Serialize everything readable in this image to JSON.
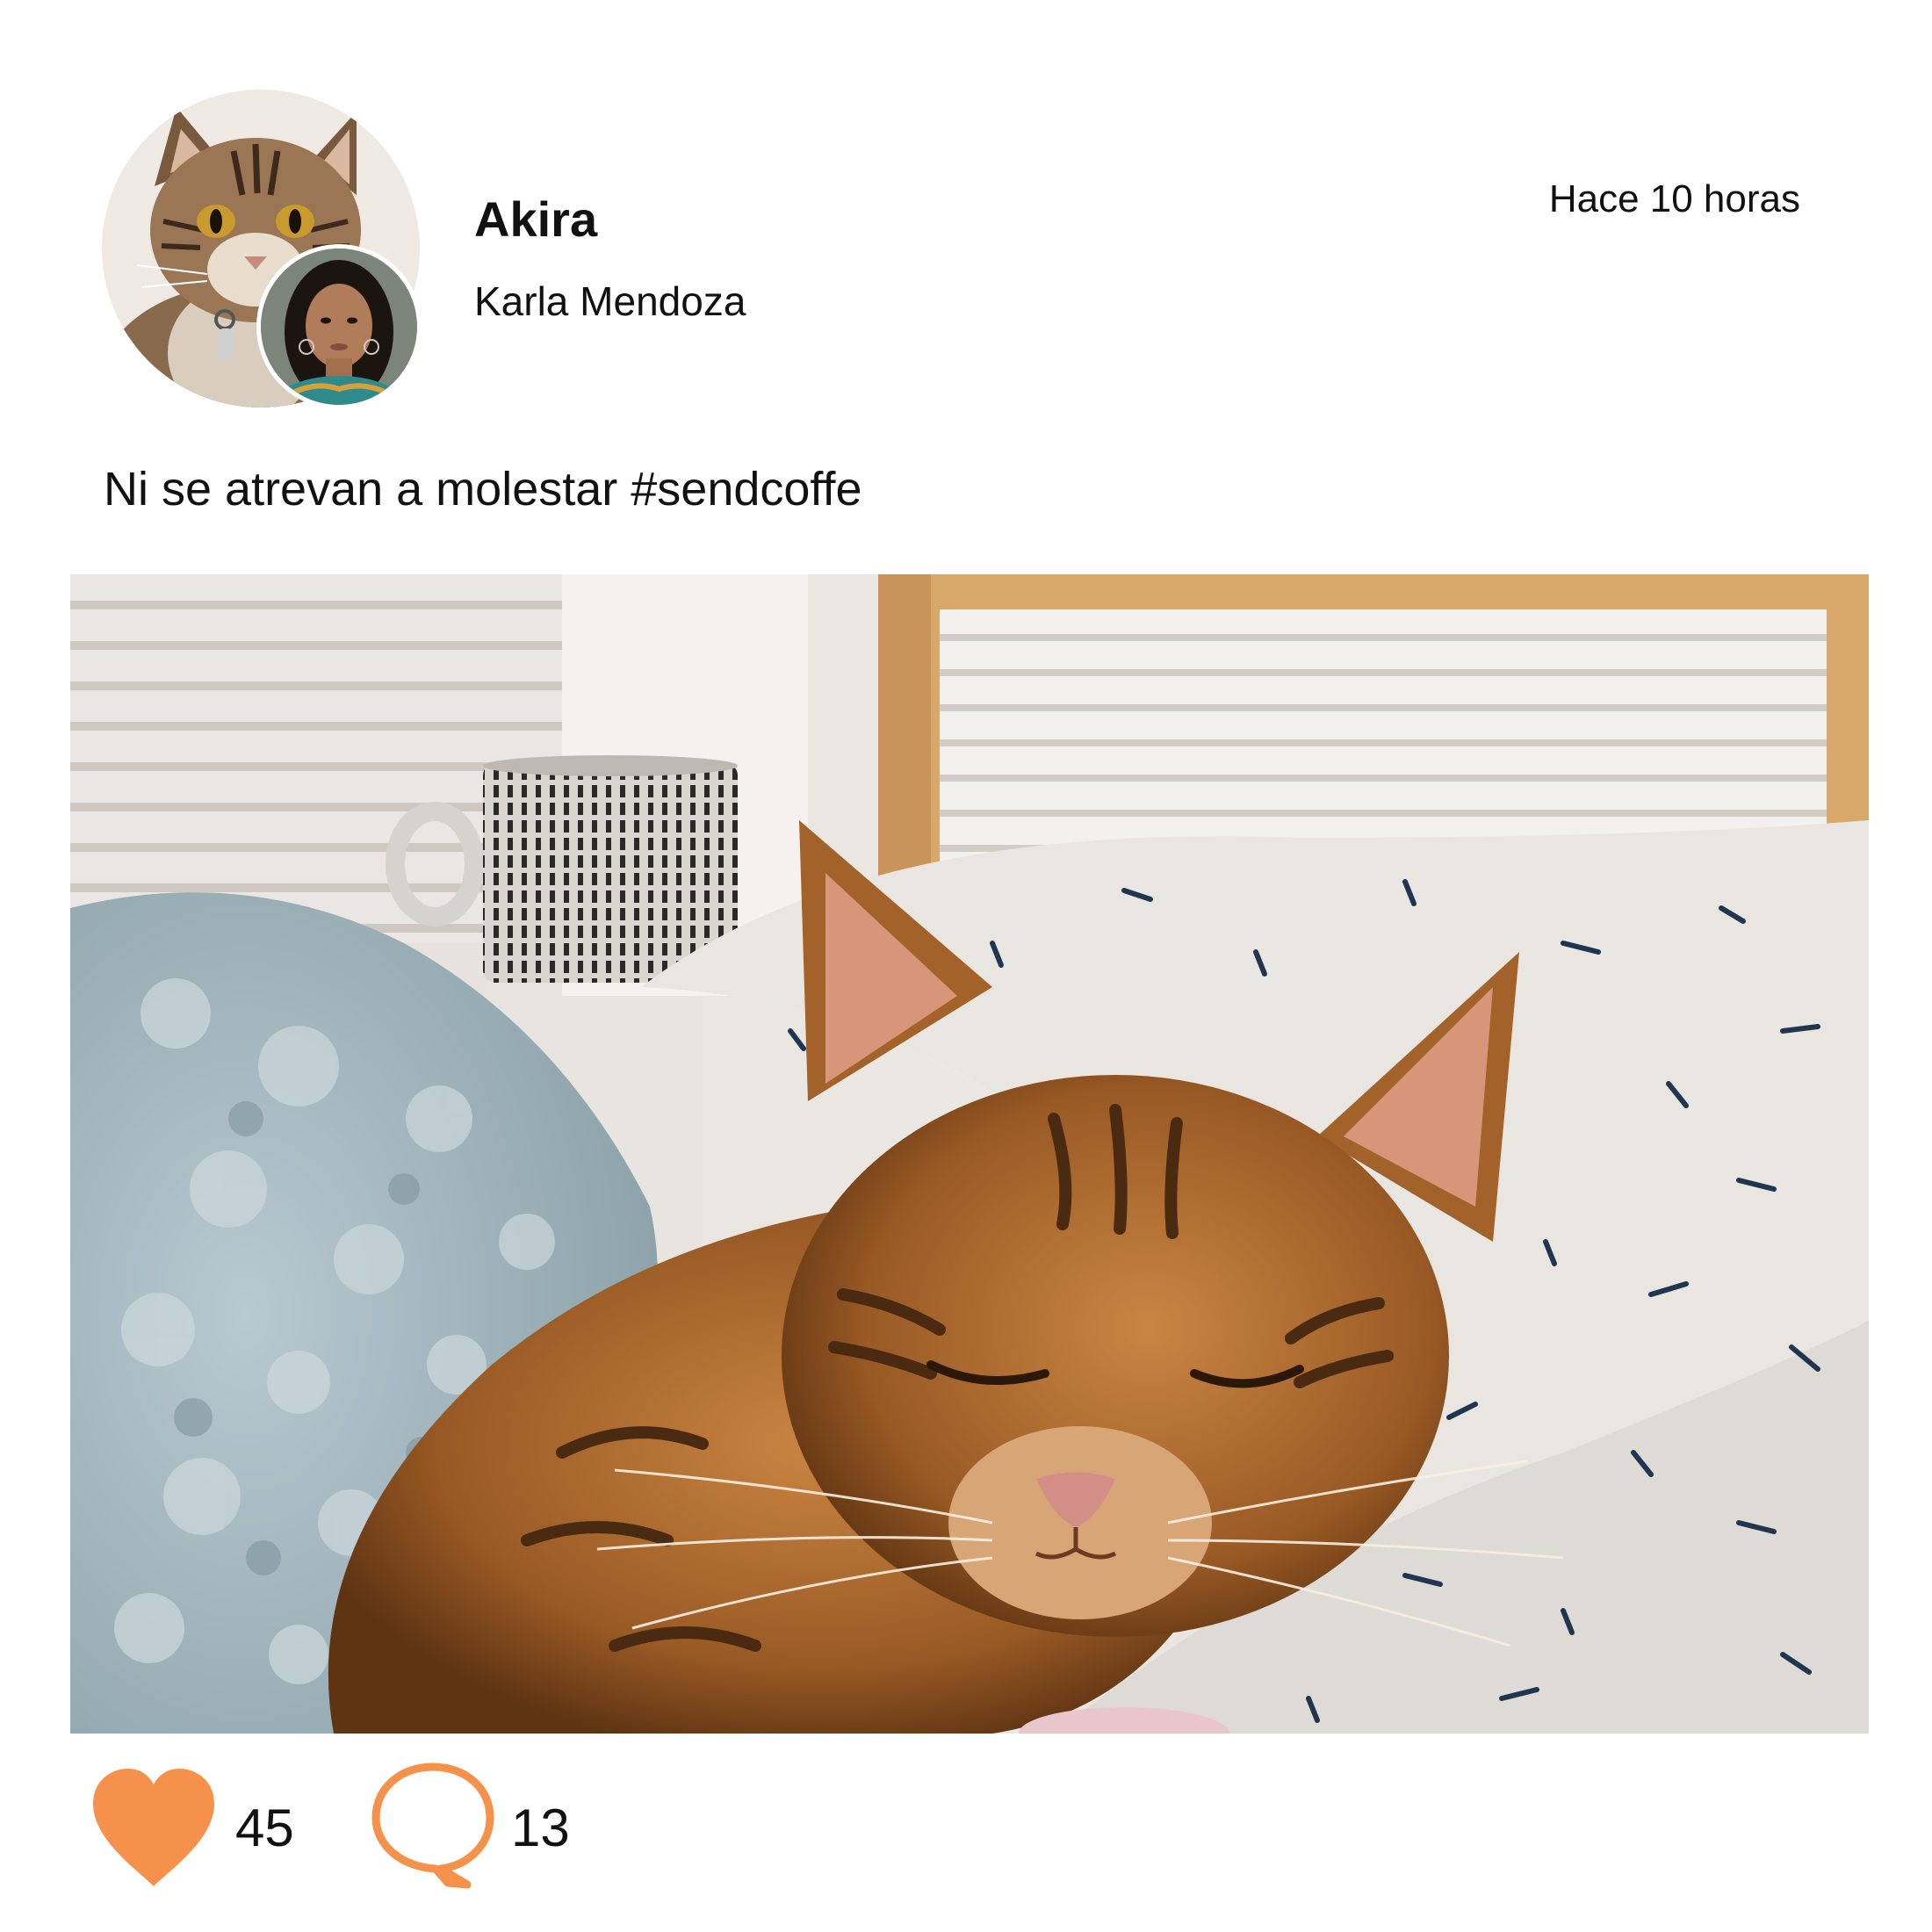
{
  "post": {
    "pet_name": "Akira",
    "owner_name": "Karla Mendoza",
    "time_ago": "Hace 10 horas",
    "caption": "Ni se atrevan a molestar #sendcoffe",
    "likes": "45",
    "comments": "13"
  },
  "icons": {
    "like": "heart-icon",
    "comment": "speech-bubble-icon"
  },
  "colors": {
    "accent": "#F5914A",
    "text": "#111111",
    "background": "#FFFFFF"
  }
}
